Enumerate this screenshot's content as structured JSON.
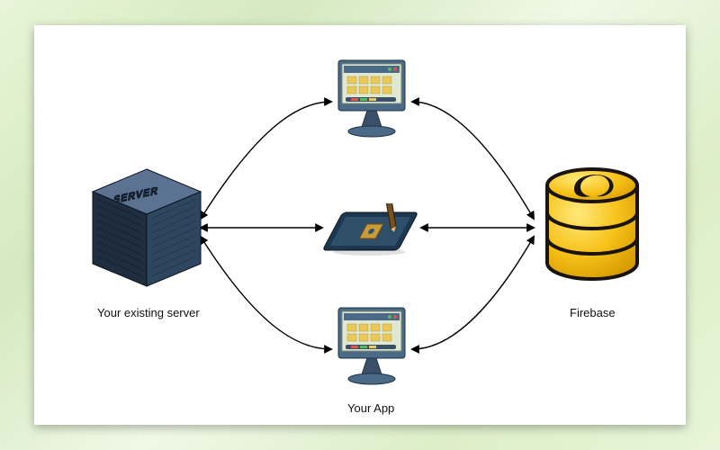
{
  "diagram": {
    "left_label": "Your existing server",
    "center_label": "Your App",
    "right_label": "Firebase",
    "nodes": {
      "server": {
        "role": "existing-server",
        "icon": "server-cube"
      },
      "client_top": {
        "role": "app-instance",
        "icon": "desktop-app"
      },
      "client_mid": {
        "role": "app-instance",
        "icon": "tablet-app"
      },
      "client_bot": {
        "role": "app-instance",
        "icon": "desktop-app"
      },
      "firebase": {
        "role": "firebase-db",
        "icon": "database-yellow"
      }
    },
    "edges": [
      {
        "from": "server",
        "to": "client_top",
        "bidirectional": true
      },
      {
        "from": "server",
        "to": "client_mid",
        "bidirectional": true
      },
      {
        "from": "server",
        "to": "client_bot",
        "bidirectional": true
      },
      {
        "from": "firebase",
        "to": "client_top",
        "bidirectional": true
      },
      {
        "from": "firebase",
        "to": "client_mid",
        "bidirectional": true
      },
      {
        "from": "firebase",
        "to": "client_bot",
        "bidirectional": true
      }
    ],
    "colors": {
      "arrow": "#000000",
      "server_body": "#2a3d55",
      "firebase_yellow": "#f7c21a",
      "firebase_dark": "#1a1410",
      "monitor_frame": "#4a6a88",
      "monitor_screen": "#dfe8d2"
    }
  }
}
